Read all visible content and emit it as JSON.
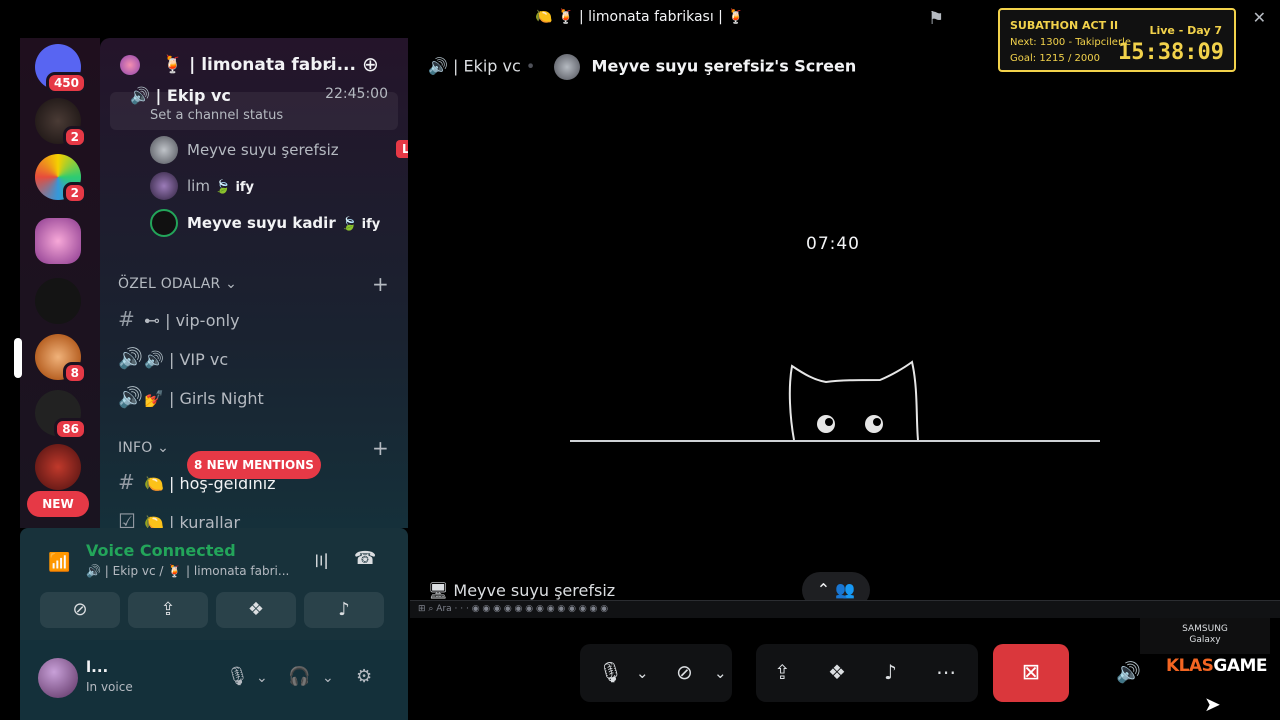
{
  "window": {
    "title": "🍋 🍹 | limonata fabrikası | 🍹"
  },
  "overlay": {
    "label": "SUBATHON ACT II",
    "day": "Live - Day 7",
    "next": "Next: 1300 - Takipcilerle",
    "goal": "Goal: 1215 / 2000",
    "timer": "15:38:09"
  },
  "rail": {
    "badges": [
      "450",
      "2",
      "2",
      "8",
      "86"
    ],
    "new_label": "NEW"
  },
  "server": {
    "name": "🍹 | limonata fabri..."
  },
  "voice_channel": {
    "name": "🔊 | Ekip vc",
    "time": "22:45:00",
    "status": "Set a channel status"
  },
  "members": [
    {
      "name": "Meyve suyu şerefsiz",
      "live": "LIVE"
    },
    {
      "name": "lim",
      "tag": "🍃 ify"
    },
    {
      "name": "Meyve suyu kadir",
      "tag": "🍃 ify"
    }
  ],
  "categories": [
    {
      "label": "ÖZEL ODALAR ⌄"
    },
    {
      "label": "INFO ⌄"
    }
  ],
  "channels": [
    {
      "icon": "#",
      "label": "⊷ | vip-only"
    },
    {
      "icon": "🔊",
      "label": "🔊 | VIP vc"
    },
    {
      "icon": "🔊",
      "label": "💅 | Girls Night"
    },
    {
      "icon": "#",
      "label": "🍋 | hoş-geldiniz"
    },
    {
      "icon": "☑",
      "label": "🍋 | kurallar"
    }
  ],
  "mentions": "8 NEW MENTIONS",
  "voice_panel": {
    "title": "Voice Connected",
    "subtitle": "🔊 | Ekip vc / 🍹 | limonata fabri..."
  },
  "user": {
    "name": "l...",
    "status": "In voice"
  },
  "stream": {
    "channel": "🔊 | Ekip vc",
    "screen_title": "Meyve suyu şerefsiz's Screen",
    "clock": "07:40",
    "streamer": "Meyve suyu şerefsiz"
  },
  "watermark": {
    "brand_small": "SAMSUNG",
    "brand_sub": "Galaxy",
    "klas_a": "KLAS",
    "klas_b": "GAME"
  }
}
